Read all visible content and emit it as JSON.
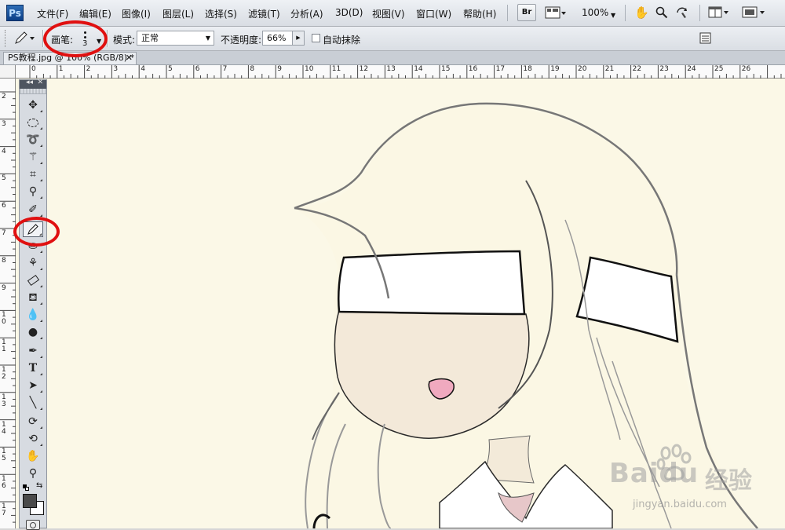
{
  "app": {
    "logo": "Ps"
  },
  "menu": [
    {
      "label": "文件(F)"
    },
    {
      "label": "编辑(E)"
    },
    {
      "label": "图像(I)"
    },
    {
      "label": "图层(L)"
    },
    {
      "label": "选择(S)"
    },
    {
      "label": "滤镜(T)"
    },
    {
      "label": "分析(A)"
    },
    {
      "label": "3D(D)"
    },
    {
      "label": "视图(V)"
    },
    {
      "label": "窗口(W)"
    },
    {
      "label": "帮助(H)"
    }
  ],
  "appbar": {
    "bridge": "Br",
    "zoom": "100%",
    "icons": [
      "bridge-icon",
      "mini-bridge-icon",
      "hand-icon",
      "zoom-icon",
      "rotate-view-icon",
      "arrange-documents-icon",
      "screen-mode-icon"
    ]
  },
  "options": {
    "brush_label": "画笔:",
    "brush_size": "3",
    "mode_label": "模式:",
    "mode_value": "正常",
    "opacity_label": "不透明度:",
    "opacity_value": "66%",
    "auto_erase_label": "自动抹除",
    "auto_erase_checked": false
  },
  "document_tab": {
    "title": "PS教程.jpg @ 100% (RGB/8) *",
    "close": "✕"
  },
  "ruler": {
    "h_labels": [
      "0",
      "1",
      "2",
      "3",
      "4",
      "5",
      "6",
      "7",
      "8",
      "9",
      "10",
      "11",
      "12",
      "13",
      "14",
      "15",
      "16",
      "17",
      "18",
      "19",
      "20",
      "21",
      "22",
      "23",
      "24",
      "25",
      "26"
    ],
    "v_labels": [
      "2",
      "3",
      "4",
      "5",
      "6",
      "7",
      "8",
      "9",
      "10",
      "11",
      "12",
      "13",
      "14",
      "15",
      "16",
      "17"
    ]
  },
  "toolbox": {
    "tools": [
      {
        "name": "move-tool",
        "icon": "move-icon"
      },
      {
        "name": "marquee-tool",
        "icon": "ellipse-marquee-icon"
      },
      {
        "name": "lasso-tool",
        "icon": "lasso-icon"
      },
      {
        "name": "magic-wand-tool",
        "icon": "magic-wand-icon"
      },
      {
        "name": "crop-tool",
        "icon": "crop-icon"
      },
      {
        "name": "eyedropper-tool",
        "icon": "eyedropper-icon"
      },
      {
        "name": "healing-brush-tool",
        "icon": "bandage-icon"
      },
      {
        "name": "pencil-tool",
        "icon": "pencil-icon",
        "active": true
      },
      {
        "name": "clone-stamp-tool",
        "icon": "stamp-icon"
      },
      {
        "name": "history-brush-tool",
        "icon": "history-brush-icon"
      },
      {
        "name": "eraser-tool",
        "icon": "eraser-icon"
      },
      {
        "name": "paint-bucket-tool",
        "icon": "paint-bucket-icon"
      },
      {
        "name": "blur-tool",
        "icon": "water-drop-icon"
      },
      {
        "name": "dodge-tool",
        "icon": "dodge-icon"
      },
      {
        "name": "pen-tool",
        "icon": "pen-icon"
      },
      {
        "name": "type-tool",
        "icon": "type-icon"
      },
      {
        "name": "path-selection-tool",
        "icon": "arrow-icon"
      },
      {
        "name": "line-tool",
        "icon": "line-icon"
      },
      {
        "name": "3d-rotate-tool",
        "icon": "3d-rotate-icon"
      },
      {
        "name": "3d-orbit-tool",
        "icon": "3d-orbit-icon"
      },
      {
        "name": "hand-tool",
        "icon": "hand-icon"
      },
      {
        "name": "zoom-tool",
        "icon": "magnifier-icon"
      }
    ],
    "foreground_color": "#4a4a4a",
    "background_color": "#ffffff"
  },
  "colors": {
    "canvas": "#fbf8e7",
    "skin": "#f3e9d9",
    "nose": "#f0a9bf",
    "annotation": "#e01010"
  },
  "watermark": {
    "brand": "Baidu",
    "cn": "经验",
    "url": "jingyan.baidu.com"
  }
}
